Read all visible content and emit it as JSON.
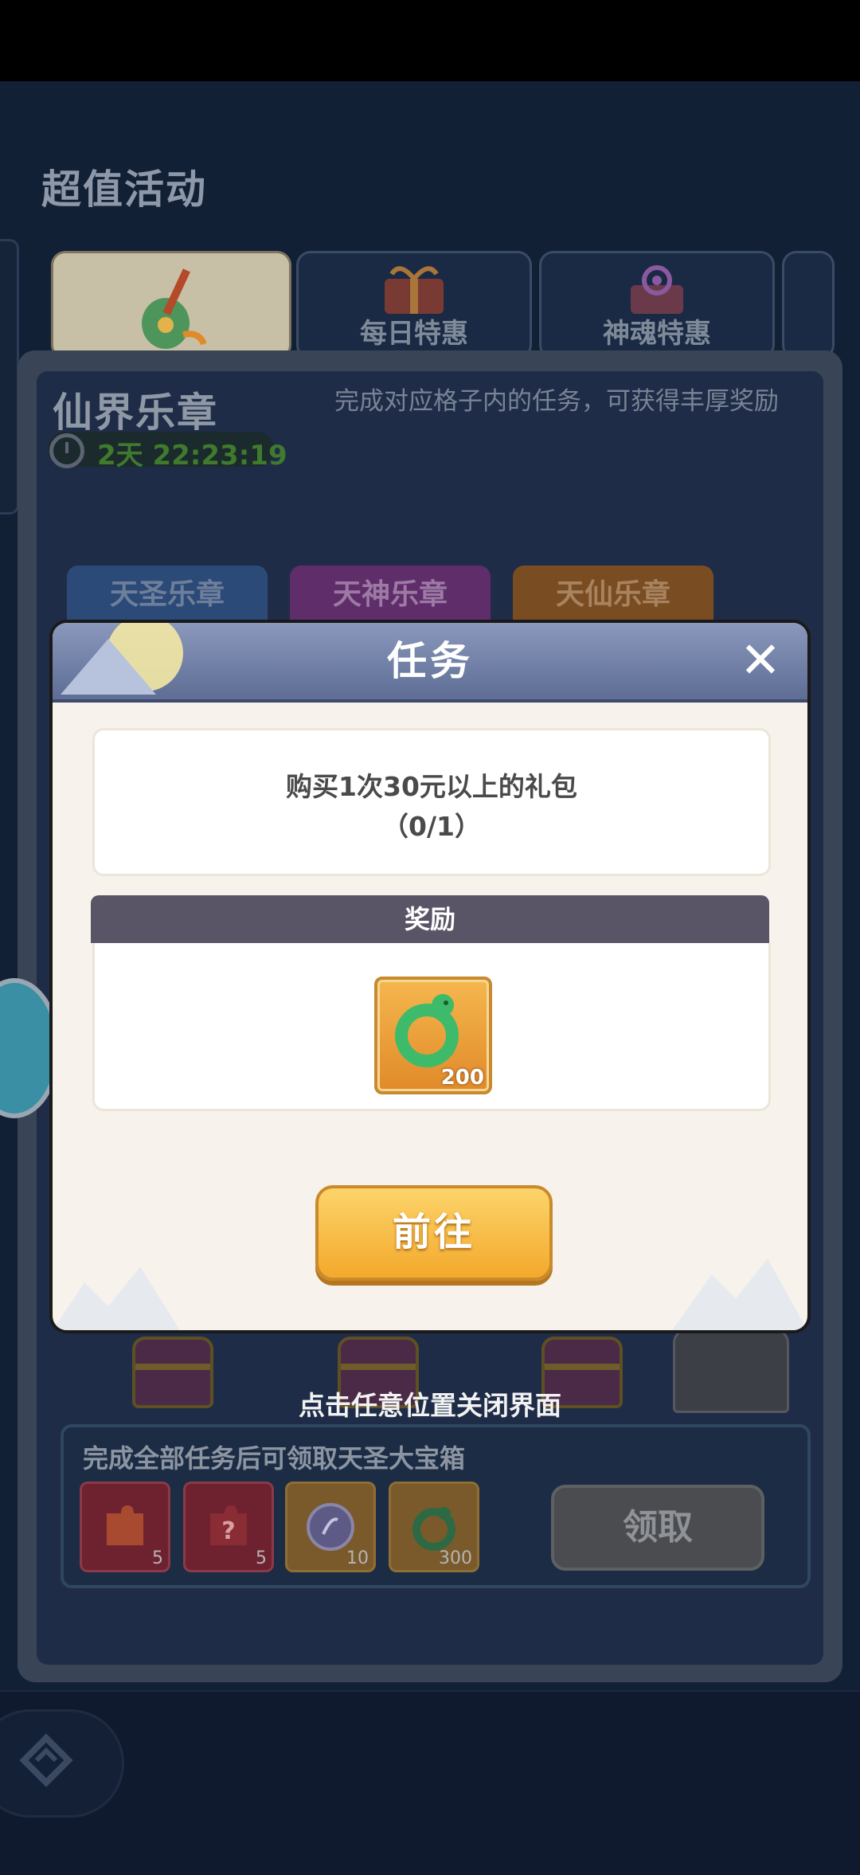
{
  "page_title": "超值活动",
  "tabs": [
    {
      "label": "",
      "icon": "lute-icon",
      "active": true
    },
    {
      "label": "每日特惠",
      "icon": "gift-box-icon",
      "active": false
    },
    {
      "label": "神魂特惠",
      "icon": "spirit-gift-icon",
      "active": false
    }
  ],
  "event": {
    "title": "仙界乐章",
    "timer": "2天 22:23:19",
    "description": "完成对应格子内的任务，可获得丰厚奖励"
  },
  "sub_tabs": [
    "天圣乐章",
    "天神乐章",
    "天仙乐章"
  ],
  "close_hint": "点击任意位置关闭界面",
  "bottom_panel": {
    "text": "完成全部任务后可领取天圣大宝箱",
    "items": [
      {
        "icon": "puzzle-piece-icon",
        "count": "5"
      },
      {
        "icon": "mystery-puzzle-icon",
        "count": "5"
      },
      {
        "icon": "spirit-coin-icon",
        "count": "10"
      },
      {
        "icon": "jade-dragon-icon",
        "count": "300"
      }
    ],
    "claim_label": "领取"
  },
  "dialog": {
    "title": "任务",
    "close_label": "✕",
    "task_text": "购买1次30元以上的礼包",
    "task_progress": "（0/1）",
    "reward_header": "奖励",
    "reward_item": {
      "icon": "jade-dragon-icon",
      "count": "200"
    },
    "go_label": "前往"
  }
}
